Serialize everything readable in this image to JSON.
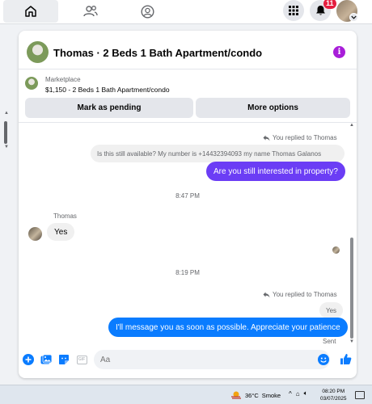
{
  "topnav": {
    "notification_count": "11",
    "icons": [
      "home-icon",
      "friends-icon",
      "groups-icon",
      "menu-grid-icon",
      "bell-icon",
      "avatar"
    ]
  },
  "chat": {
    "title": "Thomas · 2 Beds 1 Bath Apartment/condo",
    "listing": {
      "source": "Marketplace",
      "description": "$1,150 - 2 Beds 1 Bath Apartment/condo"
    },
    "buttons": {
      "mark_pending": "Mark as pending",
      "more_options": "More options"
    },
    "messages": {
      "reply1_label": "You replied to Thomas",
      "quoted1": "Is this still available? My number is +14432394093 my name Thomas Galanos",
      "out1": "Are you still interested in property?",
      "time1": "8:47 PM",
      "sender_name": "Thomas",
      "in1": "Yes",
      "time2": "8:19 PM",
      "reply2_label": "You replied to Thomas",
      "quoted2": "Yes",
      "out2": "I'll message you as soon as possible. Appreciate your patience",
      "status": "Sent"
    },
    "composer": {
      "placeholder": "Aa"
    },
    "colors": {
      "accent_blue": "#0a7cff",
      "purple_bubble": "#6b3df5",
      "info_purple": "#a81ed9",
      "badge_red": "#e41e3f"
    }
  },
  "taskbar": {
    "weather_temp": "36°C",
    "weather_text": "Smoke",
    "time": "08:20 PM",
    "date": "03/07/2025"
  }
}
